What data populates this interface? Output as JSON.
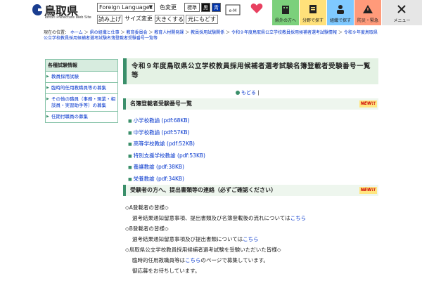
{
  "header": {
    "logo_text": "鳥取県",
    "logo_sub": "Tottori Prefecture Web Site",
    "lang_select": "Foreign Languages",
    "color_label": "色変更",
    "color_std": "標準",
    "color_black": "黒",
    "color_blue": "青",
    "read_aloud": "読み上げ",
    "font_size_label": "サイズ変更",
    "larger": "大きくする",
    "reset": "元にもどす",
    "emap_label": "e-MAP",
    "heart_label": "電話でお問い合わせ",
    "nav": [
      {
        "label": "県外の方へ"
      },
      {
        "label": "分野で探す"
      },
      {
        "label": "組織で探す"
      },
      {
        "label": "防災・緊急"
      },
      {
        "label": "メニュー"
      }
    ]
  },
  "breadcrumb": {
    "prefix": "現在の位置：",
    "items": [
      "ホーム",
      "県の組織と仕事",
      "教育委員会",
      "教育人材開発課",
      "教員採用試験関係",
      "令和９年度鳥取県公立学校教員採用候補者選考試験情報",
      "令和９年度鳥取県公立学校教員採用候補者選考試験名簿登載者受験番号一覧等"
    ]
  },
  "sidebar": {
    "title": "各種試験情報",
    "items": [
      {
        "label": "教員採用試験"
      },
      {
        "label": "臨時的任用教職員等の募集"
      },
      {
        "label": "その他の職員（事務・現業・相談員・実習助手等）の募集"
      },
      {
        "label": "任期付職員の募集"
      }
    ]
  },
  "main": {
    "title": "令和９年度鳥取県公立学校教員採用候補者選考試験名簿登載者受験番号一覧等",
    "back_label": "もどる",
    "sec1_title": "名簿登載者受験番号一覧",
    "new_label": "NEW!!",
    "downloads": [
      {
        "label": "小学校教諭 (pdf:68KB)"
      },
      {
        "label": "中学校教諭 (pdf:57KB)"
      },
      {
        "label": "高等学校教諭 (pdf:52KB)"
      },
      {
        "label": "特別支援学校教諭 (pdf:53KB)"
      },
      {
        "label": "養護教諭 (pdf:38KB)"
      },
      {
        "label": "栄養教諭 (pdf:34KB)"
      }
    ],
    "sec2_title": "受験者の方へ、提出書類等の連絡（必ずご確認ください）",
    "notice": {
      "a_head": "◇A登載者の皆様◇",
      "a_text": "選考結果通知留意事項、提出書類及び名簿登載後の流れについては",
      "a_link": "こちら",
      "b_head": "◇B登載者の皆様◇",
      "b_text": "選考結果通知留意事項及び提出書類については",
      "b_link": "こちら",
      "c_head": "◇鳥取県公立学校教員採用候補者選考試験を受験いただいた皆様◇",
      "c_text1": "臨時的任用教職員等は",
      "c_link": "こちら",
      "c_text2": "のページで募集しています。",
      "c_text3": "御応募をお待ちしています。"
    }
  }
}
